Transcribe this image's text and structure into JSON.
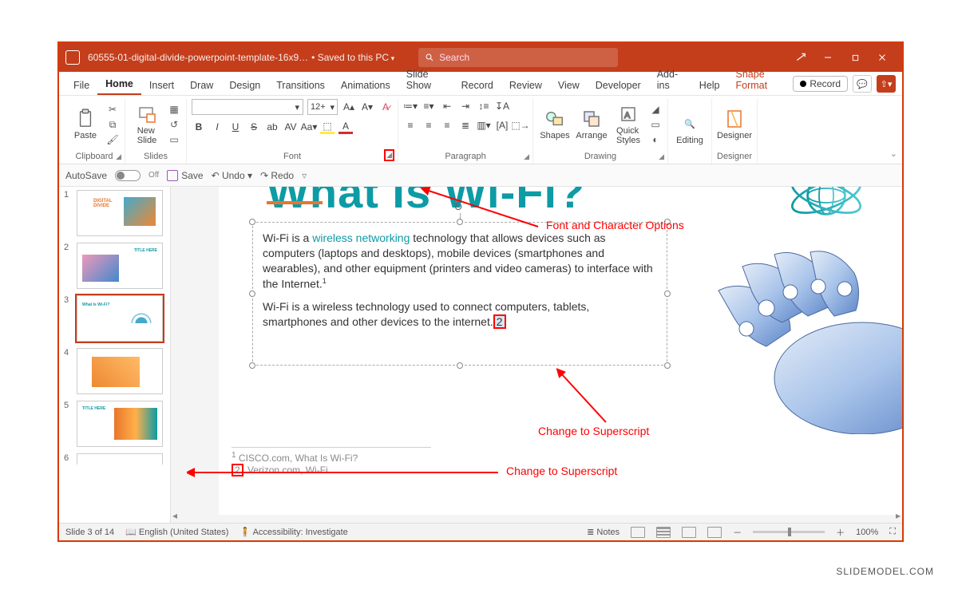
{
  "titlebar": {
    "docname": "60555-01-digital-divide-powerpoint-template-16x9…",
    "saved": "• Saved to this PC",
    "search_placeholder": "Search"
  },
  "tabs": [
    "File",
    "Home",
    "Insert",
    "Draw",
    "Design",
    "Transitions",
    "Animations",
    "Slide Show",
    "Record",
    "Review",
    "View",
    "Developer",
    "Add-ins",
    "Help",
    "Shape Format"
  ],
  "tabs_active": "Home",
  "record_label": "Record",
  "ribbon": {
    "clipboard": {
      "paste": "Paste",
      "group": "Clipboard"
    },
    "slides": {
      "newslide": "New\nSlide",
      "group": "Slides"
    },
    "font": {
      "size": "12+",
      "group": "Font"
    },
    "paragraph": {
      "group": "Paragraph"
    },
    "drawing": {
      "shapes": "Shapes",
      "arrange": "Arrange",
      "quick": "Quick\nStyles",
      "group": "Drawing"
    },
    "editing": {
      "label": "Editing"
    },
    "designer": {
      "label": "Designer",
      "group": "Designer"
    }
  },
  "quick": {
    "autosave": "AutoSave",
    "off": "Off",
    "save": "Save",
    "undo": "Undo",
    "redo": "Redo"
  },
  "thumbs": [
    "1",
    "2",
    "3",
    "4",
    "5",
    "6"
  ],
  "slide": {
    "title": "What Is Wi-Fi?",
    "p1a": "Wi-Fi is a ",
    "p1link": "wireless networking",
    "p1b": " technology that allows devices such as computers (laptops and desktops), mobile devices (smartphones and wearables), and other equipment (printers and video cameras) to interface with the Internet.",
    "sup1": "1",
    "p2": "Wi-Fi is a wireless technology used to connect computers, tablets, smartphones and other devices to the internet.",
    "sel2": "2",
    "foot1": " CISCO.com, What Is Wi-Fi?",
    "foot1sup": "1",
    "foot2mark": "2",
    "foot2": " Verizon.com, Wi-Fi"
  },
  "annotations": {
    "fontoptions": "Font and Character Options",
    "changesuper_a": "Change to Superscript",
    "changesuper_b": "Change to Superscript"
  },
  "status": {
    "slide": "Slide 3 of 14",
    "lang": "English (United States)",
    "access": "Accessibility: Investigate",
    "notes": "Notes",
    "zoom": "100%"
  },
  "watermark": "SLIDEMODEL.COM"
}
